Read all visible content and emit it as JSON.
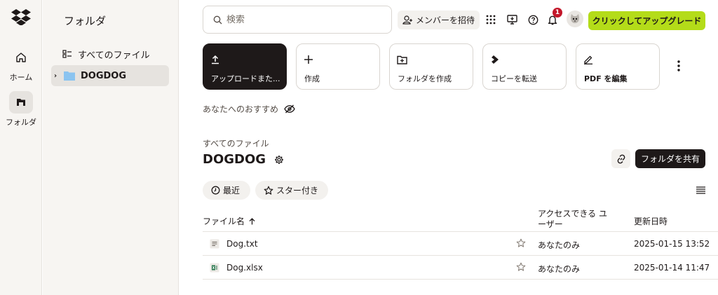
{
  "rail": {
    "home_label": "ホーム",
    "folder_label": "フォルダ"
  },
  "sidebar": {
    "title": "フォルダ",
    "items": [
      {
        "label": "すべてのファイル"
      },
      {
        "label": "DOGDOG"
      }
    ]
  },
  "topbar": {
    "search_placeholder": "検索",
    "invite_label": "メンバーを招待",
    "notification_count": "1",
    "upgrade_label": "クリックしてアップグレード"
  },
  "tiles": [
    {
      "label": "アップロードまた..."
    },
    {
      "label": "作成"
    },
    {
      "label": "フォルダを作成"
    },
    {
      "label": "コピーを転送"
    },
    {
      "label": "PDF を編集"
    }
  ],
  "recommend_label": "あなたへのおすすめ",
  "breadcrumb": "すべてのファイル",
  "page_title": "DOGDOG",
  "share_label": "フォルダを共有",
  "filters": {
    "recent": "最近",
    "starred": "スター付き"
  },
  "table": {
    "columns": {
      "name": "ファイル名",
      "access": "アクセスできる ユーザー",
      "modified": "更新日時"
    },
    "rows": [
      {
        "name": "Dog.txt",
        "access": "あなたのみ",
        "modified": "2025-01-15 13:52"
      },
      {
        "name": "Dog.xlsx",
        "access": "あなたのみ",
        "modified": "2025-01-14 11:47"
      }
    ]
  },
  "colors": {
    "accent": "#b4dc19",
    "dark": "#1e1919",
    "folder": "#8bc4f0",
    "badge": "#c3172a",
    "excel": "#1d7044"
  }
}
